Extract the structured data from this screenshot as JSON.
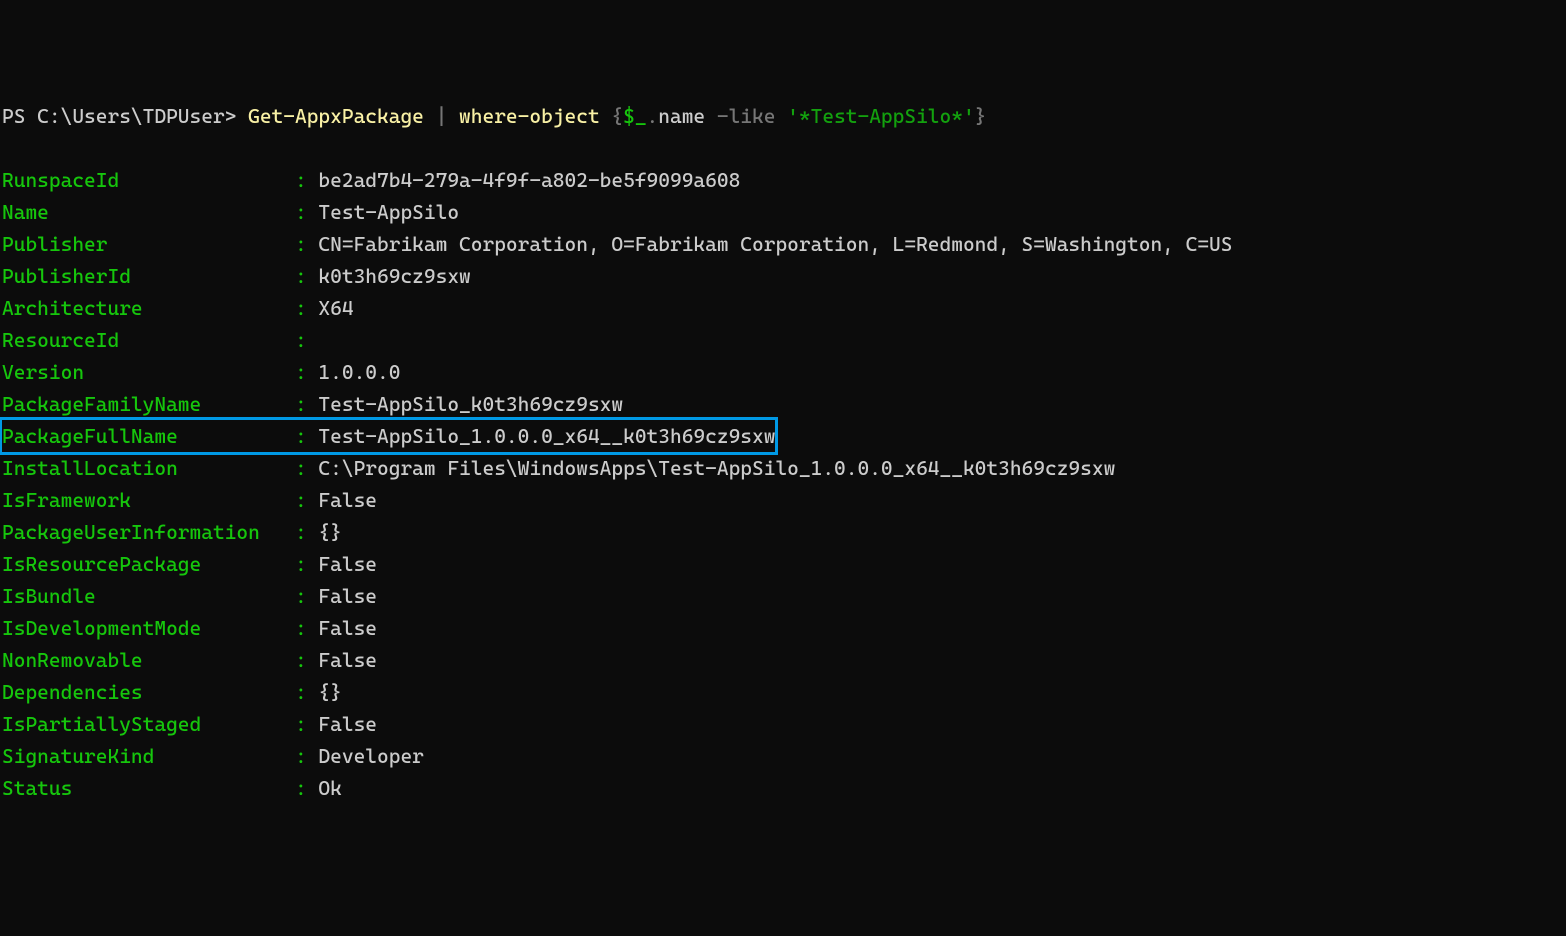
{
  "prompt": {
    "ps": "PS ",
    "path": "C:\\Users\\TDPUser> ",
    "cmd1": "Get-AppxPackage ",
    "pipe": "| ",
    "cmd2": "where-object ",
    "brace_open": "{",
    "var": "$_",
    "dot": ".",
    "name_prop": "name ",
    "like": "-like ",
    "str": "'*Test-AppSilo*'",
    "brace_close": "}"
  },
  "keyWidth": 25,
  "rows": [
    {
      "key": "RunspaceId",
      "value": "be2ad7b4-279a-4f9f-a802-be5f9099a608"
    },
    {
      "key": "Name",
      "value": "Test-AppSilo"
    },
    {
      "key": "Publisher",
      "value": "CN=Fabrikam Corporation, O=Fabrikam Corporation, L=Redmond, S=Washington, C=US"
    },
    {
      "key": "PublisherId",
      "value": "k0t3h69cz9sxw"
    },
    {
      "key": "Architecture",
      "value": "X64"
    },
    {
      "key": "ResourceId",
      "value": ""
    },
    {
      "key": "Version",
      "value": "1.0.0.0"
    },
    {
      "key": "PackageFamilyName",
      "value": "Test-AppSilo_k0t3h69cz9sxw"
    },
    {
      "key": "PackageFullName",
      "value": "Test-AppSilo_1.0.0.0_x64__k0t3h69cz9sxw",
      "highlight": true
    },
    {
      "key": "InstallLocation",
      "value": "C:\\Program Files\\WindowsApps\\Test-AppSilo_1.0.0.0_x64__k0t3h69cz9sxw"
    },
    {
      "key": "IsFramework",
      "value": "False"
    },
    {
      "key": "PackageUserInformation",
      "value": "{}"
    },
    {
      "key": "IsResourcePackage",
      "value": "False"
    },
    {
      "key": "IsBundle",
      "value": "False"
    },
    {
      "key": "IsDevelopmentMode",
      "value": "False"
    },
    {
      "key": "NonRemovable",
      "value": "False"
    },
    {
      "key": "Dependencies",
      "value": "{}"
    },
    {
      "key": "IsPartiallyStaged",
      "value": "False"
    },
    {
      "key": "SignatureKind",
      "value": "Developer"
    },
    {
      "key": "Status",
      "value": "Ok"
    }
  ]
}
